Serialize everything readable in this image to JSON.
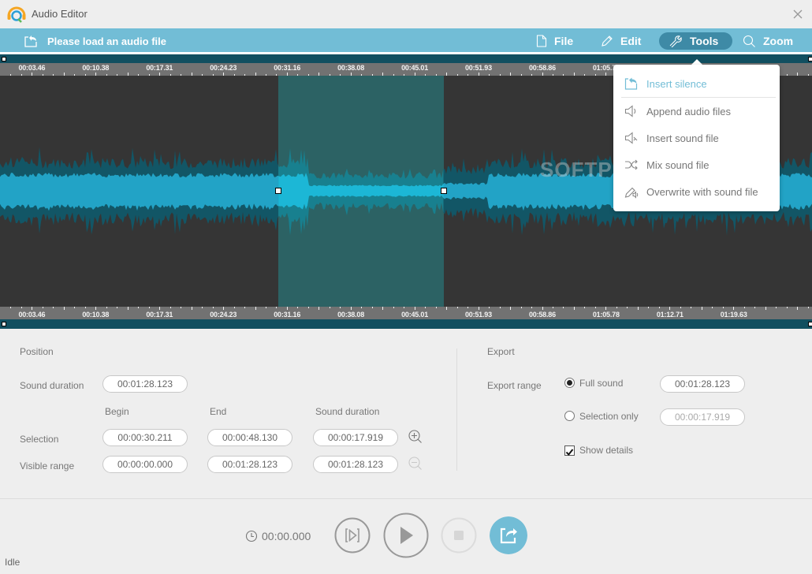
{
  "window": {
    "title": "Audio Editor",
    "logo_icon": "app-logo-icon",
    "close_icon": "close-icon"
  },
  "toolbar": {
    "load_label": "Please load an audio file",
    "load_icon": "open-file-icon",
    "menus": [
      {
        "label": "File",
        "icon": "file-icon",
        "active": false
      },
      {
        "label": "Edit",
        "icon": "pencil-icon",
        "active": false
      },
      {
        "label": "Tools",
        "icon": "wrench-icon",
        "active": true
      },
      {
        "label": "Zoom",
        "icon": "search-icon",
        "active": false
      }
    ]
  },
  "tools_menu": {
    "items": [
      {
        "label": "Insert silence",
        "icon": "insert-silence-icon",
        "highlighted": true
      },
      {
        "label": "Append audio files",
        "icon": "speaker-icon",
        "highlighted": false
      },
      {
        "label": "Insert sound file",
        "icon": "speaker-insert-icon",
        "highlighted": false
      },
      {
        "label": "Mix sound file",
        "icon": "shuffle-icon",
        "highlighted": false
      },
      {
        "label": "Overwrite with sound file",
        "icon": "pencil-speaker-icon",
        "highlighted": false
      }
    ]
  },
  "timeline": {
    "ticks": [
      "00:03.46",
      "00:10.38",
      "00:17.31",
      "00:24.23",
      "00:31.16",
      "00:38.08",
      "00:45.01",
      "00:51.93",
      "00:58.86",
      "01:05.78",
      "01:12.71",
      "01:19.63"
    ],
    "total_seconds": 88.123,
    "selection_start_seconds": 30.211,
    "selection_end_seconds": 48.13,
    "watermark": "SOFTPEDIA",
    "colors": {
      "waveform_outer": "#125666",
      "waveform_inner": "#22a3c6",
      "selection_outer": "#18808f",
      "selection_inner": "#1cb7d6",
      "selection_bg": "#2c6264",
      "background": "#353535"
    }
  },
  "position": {
    "title": "Position",
    "sound_duration_label": "Sound duration",
    "sound_duration_value": "00:01:28.123",
    "col_begin": "Begin",
    "col_end": "End",
    "col_duration": "Sound duration",
    "selection_label": "Selection",
    "selection": {
      "begin": "00:00:30.211",
      "end": "00:00:48.130",
      "duration": "00:00:17.919"
    },
    "visible_label": "Visible range",
    "visible": {
      "begin": "00:00:00.000",
      "end": "00:01:28.123",
      "duration": "00:01:28.123"
    }
  },
  "export": {
    "title": "Export",
    "range_label": "Export range",
    "full_label": "Full sound",
    "full_value": "00:01:28.123",
    "full_checked": true,
    "selection_label": "Selection only",
    "selection_value": "00:00:17.919",
    "selection_checked": false,
    "details_label": "Show details",
    "details_checked": true
  },
  "playback": {
    "time": "00:00.000",
    "clock_icon": "clock-icon"
  },
  "status": {
    "text": "Idle"
  }
}
